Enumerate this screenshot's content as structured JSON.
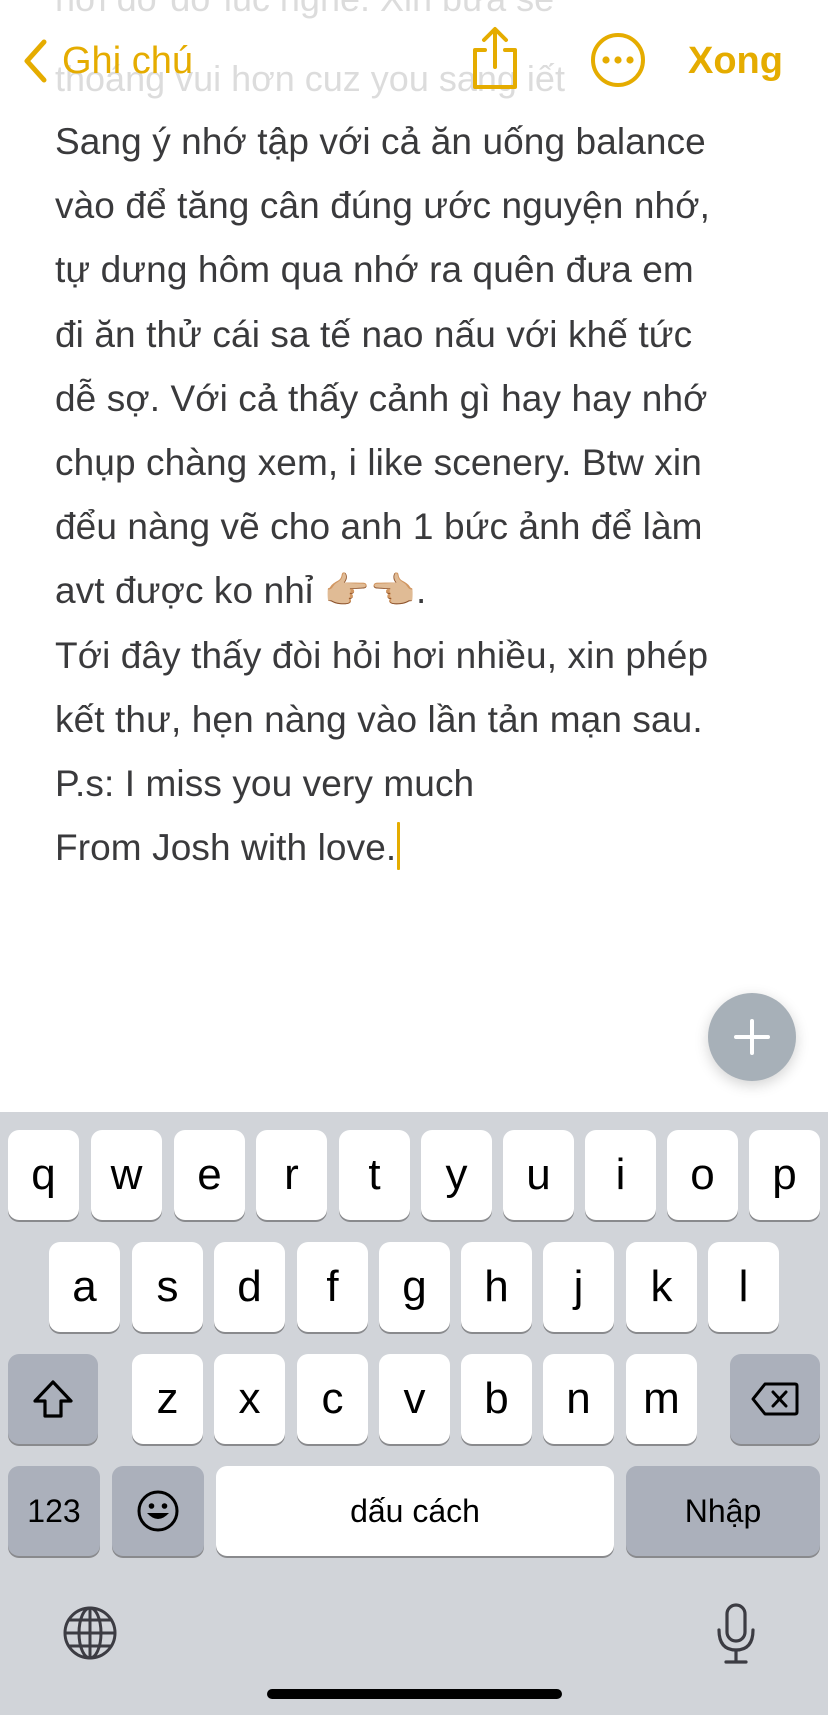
{
  "nav": {
    "back_label": "Ghi chú",
    "done_label": "Xong",
    "accent_color": "#e5ac00",
    "share_icon": "share-icon",
    "more_icon": "ellipsis-circle-icon"
  },
  "note": {
    "ghost_lines": [
      "hơi đỡ đỡ lúc nghe. Xin bữa sẽ",
      "thoáng vui hơn cuz you sang iết"
    ],
    "lines": [
      "Sang ý nhớ tập với cả ăn uống balance",
      "vào để tăng cân đúng ước nguyện nhớ,",
      "tự dưng hôm qua nhớ ra quên đưa em",
      "đi ăn thử cái sa tế nao nấu với khế tức",
      "dễ sợ. Với cả thấy cảnh gì hay hay nhớ",
      "chụp chàng xem, i like scenery. Btw xin",
      "đểu nàng vẽ cho anh 1 bức ảnh để làm",
      "avt được ko nhỉ 👉🏼👈🏼.",
      "Tới đây thấy đòi hỏi hơi nhiều, xin phép",
      "kết thư, hẹn nàng vào lần tản mạn sau.",
      "P.s: I miss you very much",
      "From Josh with love."
    ]
  },
  "fab": {
    "icon": "plus-icon"
  },
  "keyboard": {
    "row1": [
      "q",
      "w",
      "e",
      "r",
      "t",
      "y",
      "u",
      "i",
      "o",
      "p"
    ],
    "row2": [
      "a",
      "s",
      "d",
      "f",
      "g",
      "h",
      "j",
      "k",
      "l"
    ],
    "row3": [
      "z",
      "x",
      "c",
      "v",
      "b",
      "n",
      "m"
    ],
    "numbers_label": "123",
    "space_label": "dấu cách",
    "return_label": "Nhập",
    "shift_icon": "shift-icon",
    "delete_icon": "delete-icon",
    "emoji_icon": "emoji-icon",
    "globe_icon": "globe-icon",
    "mic_icon": "microphone-icon"
  }
}
